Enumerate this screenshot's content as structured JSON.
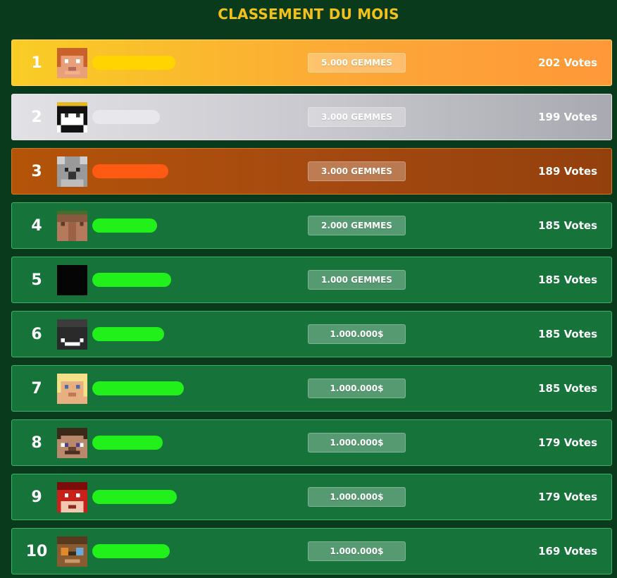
{
  "title": "CLASSEMENT DU MOIS",
  "leaderboard": [
    {
      "rank": "1",
      "reward": "5.000 GEMMES",
      "votes": "202 Votes",
      "tier": "gold",
      "name_color": "#ffd400",
      "avatar": "orange-hair-skin"
    },
    {
      "rank": "2",
      "reward": "3.000 GEMMES",
      "votes": "199 Votes",
      "tier": "silver",
      "name_color": "#e8e8ec",
      "avatar": "black-hair-skin"
    },
    {
      "rank": "3",
      "reward": "3.000 GEMMES",
      "votes": "189 Votes",
      "tier": "bronze",
      "name_color": "#ff5a14",
      "avatar": "koala-skin"
    },
    {
      "rank": "4",
      "reward": "2.000 GEMMES",
      "votes": "185 Votes",
      "tier": "green",
      "name_color": "#22f01a",
      "avatar": "villager-skin"
    },
    {
      "rank": "5",
      "reward": "1.000 GEMMES",
      "votes": "185 Votes",
      "tier": "green",
      "name_color": "#22f01a",
      "avatar": "black-skin"
    },
    {
      "rank": "6",
      "reward": "1.000.000$",
      "votes": "185 Votes",
      "tier": "green",
      "name_color": "#22f01a",
      "avatar": "dark-smile-skin"
    },
    {
      "rank": "7",
      "reward": "1.000.000$",
      "votes": "185 Votes",
      "tier": "green",
      "name_color": "#22f01a",
      "avatar": "blonde-skin"
    },
    {
      "rank": "8",
      "reward": "1.000.000$",
      "votes": "179 Votes",
      "tier": "green",
      "name_color": "#22f01a",
      "avatar": "steve-skin"
    },
    {
      "rank": "9",
      "reward": "1.000.000$",
      "votes": "179 Votes",
      "tier": "green",
      "name_color": "#22f01a",
      "avatar": "red-skin"
    },
    {
      "rank": "10",
      "reward": "1.000.000$",
      "votes": "169 Votes",
      "tier": "green",
      "name_color": "#22f01a",
      "avatar": "goggles-skin"
    }
  ]
}
